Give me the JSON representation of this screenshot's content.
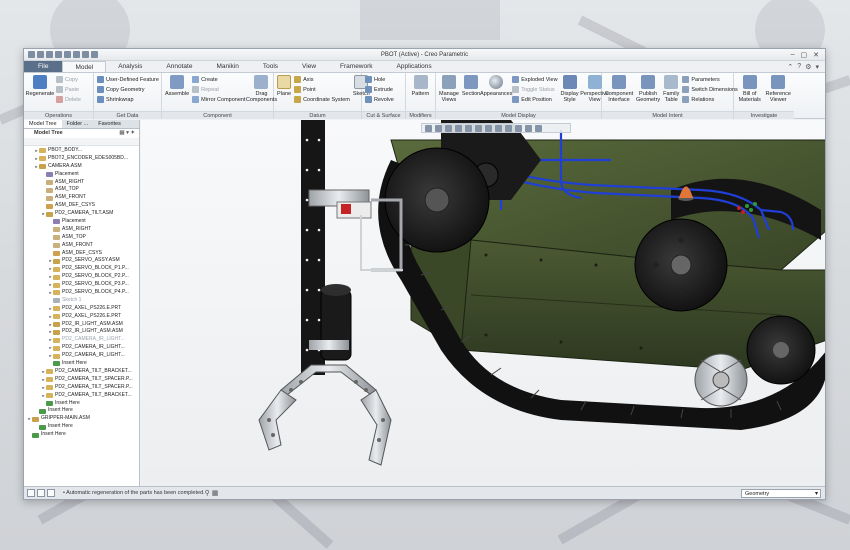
{
  "window": {
    "title": "PBOT (Active) - Creo Parametric"
  },
  "menubar": {
    "tabs": [
      "File",
      "Model",
      "Analysis",
      "Annotate",
      "Manikin",
      "Tools",
      "View",
      "Framework",
      "Applications"
    ],
    "active": "Model"
  },
  "ribbon": {
    "operations": {
      "label": "Operations",
      "regenerate": "Regenerate",
      "copy": "Copy",
      "paste": "Paste",
      "delete": "Delete"
    },
    "getdata": {
      "label": "Get Data",
      "udf": "User-Defined Feature",
      "copy_geometry": "Copy Geometry",
      "shrinkwrap": "Shrinkwrap"
    },
    "component": {
      "label": "Component",
      "assemble": "Assemble",
      "create": "Create",
      "repeat": "Repeat",
      "mirror": "Mirror Component",
      "drag": "Drag Components"
    },
    "datum": {
      "label": "Datum",
      "plane": "Plane",
      "axis": "Axis",
      "point": "Point",
      "coord": "Coordinate System",
      "sketch": "Sketch"
    },
    "cutsurface": {
      "label": "Cut & Surface",
      "hole": "Hole",
      "extrude": "Extrude",
      "revolve": "Revolve"
    },
    "modifiers": {
      "label": "Modifiers",
      "pattern": "Pattern"
    },
    "modeldisplay": {
      "label": "Model Display",
      "manage_views": "Manage Views",
      "section": "Section",
      "appearances": "Appearances",
      "exploded": "Exploded View",
      "toggle": "Toggle Status",
      "edit_position": "Edit Position",
      "display_style": "Display Style",
      "perspective": "Perspective View"
    },
    "modelintent": {
      "label": "Model Intent",
      "component_interface": "Component Interface",
      "publish_geometry": "Publish Geometry",
      "family_table": "Family Table",
      "parameters": "Parameters",
      "switch_dimensions": "Switch Dimensions",
      "relations": "Relations"
    },
    "investigate": {
      "label": "Investigate",
      "bom": "Bill of Materials",
      "reference_viewer": "Reference Viewer"
    }
  },
  "tree": {
    "tabs": [
      "Model Tree",
      "Folder ...",
      "Favorites"
    ],
    "header": "Model Tree",
    "rows": [
      {
        "t": "PBOT_BODY...",
        "indent": 1,
        "dim": false,
        "icon": "part"
      },
      {
        "t": "PBOT2_ENCODER_EDES005BD...",
        "indent": 1,
        "dim": false,
        "icon": "part"
      },
      {
        "t": "CAMERA.ASM",
        "indent": 1,
        "dim": false,
        "icon": "asm"
      },
      {
        "t": "Placement",
        "indent": 2,
        "dim": false,
        "icon": "place"
      },
      {
        "t": "ASM_RIGHT",
        "indent": 2,
        "dim": false,
        "icon": "datum"
      },
      {
        "t": "ASM_TOP",
        "indent": 2,
        "dim": false,
        "icon": "datum"
      },
      {
        "t": "ASM_FRONT",
        "indent": 2,
        "dim": false,
        "icon": "datum"
      },
      {
        "t": "ASM_DEF_CSYS",
        "indent": 2,
        "dim": false,
        "icon": "csys"
      },
      {
        "t": "PD2_CAMERA_TILT.ASM",
        "indent": 2,
        "dim": false,
        "icon": "asm"
      },
      {
        "t": "Placement",
        "indent": 3,
        "dim": false,
        "icon": "place"
      },
      {
        "t": "ASM_RIGHT",
        "indent": 3,
        "dim": false,
        "icon": "datum"
      },
      {
        "t": "ASM_TOP",
        "indent": 3,
        "dim": false,
        "icon": "datum"
      },
      {
        "t": "ASM_FRONT",
        "indent": 3,
        "dim": false,
        "icon": "datum"
      },
      {
        "t": "ASM_DEF_CSYS",
        "indent": 3,
        "dim": false,
        "icon": "csys"
      },
      {
        "t": "PD2_SERVO_ASSY.ASM",
        "indent": 3,
        "dim": false,
        "icon": "asm"
      },
      {
        "t": "PD2_SERVO_BLOCK_P1.P...",
        "indent": 3,
        "dim": false,
        "icon": "part"
      },
      {
        "t": "PD2_SERVO_BLOCK_P2.P...",
        "indent": 3,
        "dim": false,
        "icon": "part"
      },
      {
        "t": "PD2_SERVO_BLOCK_P3.P...",
        "indent": 3,
        "dim": false,
        "icon": "part"
      },
      {
        "t": "PD2_SERVO_BLOCK_P4.P...",
        "indent": 3,
        "dim": false,
        "icon": "part"
      },
      {
        "t": "Sketch 1",
        "indent": 3,
        "dim": true,
        "icon": "sketch"
      },
      {
        "t": "PD2_AXEL_PS226.E.PRT",
        "indent": 3,
        "dim": false,
        "icon": "part"
      },
      {
        "t": "PD2_AXEL_PS226.E.PRT",
        "indent": 3,
        "dim": false,
        "icon": "part"
      },
      {
        "t": "PD2_IR_LIGHT_ASM.ASM",
        "indent": 3,
        "dim": false,
        "icon": "asm"
      },
      {
        "t": "PD2_IR_LIGHT_ASM.ASM",
        "indent": 3,
        "dim": false,
        "icon": "asm"
      },
      {
        "t": "PD2_CAMERA_IR_LIGHT...",
        "indent": 3,
        "dim": true,
        "icon": "part"
      },
      {
        "t": "PD2_CAMERA_IR_LIGHT...",
        "indent": 3,
        "dim": false,
        "icon": "part"
      },
      {
        "t": "PD2_CAMERA_IR_LIGHT...",
        "indent": 3,
        "dim": false,
        "icon": "part"
      },
      {
        "t": "Insert Here",
        "indent": 3,
        "dim": false,
        "icon": "insert"
      },
      {
        "t": "PD2_CAMERA_TILT_BRACKET...",
        "indent": 2,
        "dim": false,
        "icon": "part"
      },
      {
        "t": "PD2_CAMERA_TILT_SPACER.P...",
        "indent": 2,
        "dim": false,
        "icon": "part"
      },
      {
        "t": "PD2_CAMERA_TILT_SPACER.P...",
        "indent": 2,
        "dim": false,
        "icon": "part"
      },
      {
        "t": "PD2_CAMERA_TILT_BRACKET...",
        "indent": 2,
        "dim": false,
        "icon": "part"
      },
      {
        "t": "Insert Here",
        "indent": 2,
        "dim": false,
        "icon": "insert"
      },
      {
        "t": "Insert Here",
        "indent": 1,
        "dim": false,
        "icon": "insert"
      },
      {
        "t": "GRIPPER-MAIN.ASM",
        "indent": 0,
        "dim": false,
        "icon": "asm"
      },
      {
        "t": "Insert Here",
        "indent": 1,
        "dim": false,
        "icon": "insert"
      },
      {
        "t": "Insert Here",
        "indent": 0,
        "dim": false,
        "icon": "insert"
      }
    ]
  },
  "statusbar": {
    "message": "Automatic regeneration of the parts has been completed.",
    "filter": "Geometry"
  },
  "colors": {
    "body_green": "#3c4a2a",
    "wire_blue": "#1f3fd6",
    "file_tab": "#5a6f8a"
  }
}
